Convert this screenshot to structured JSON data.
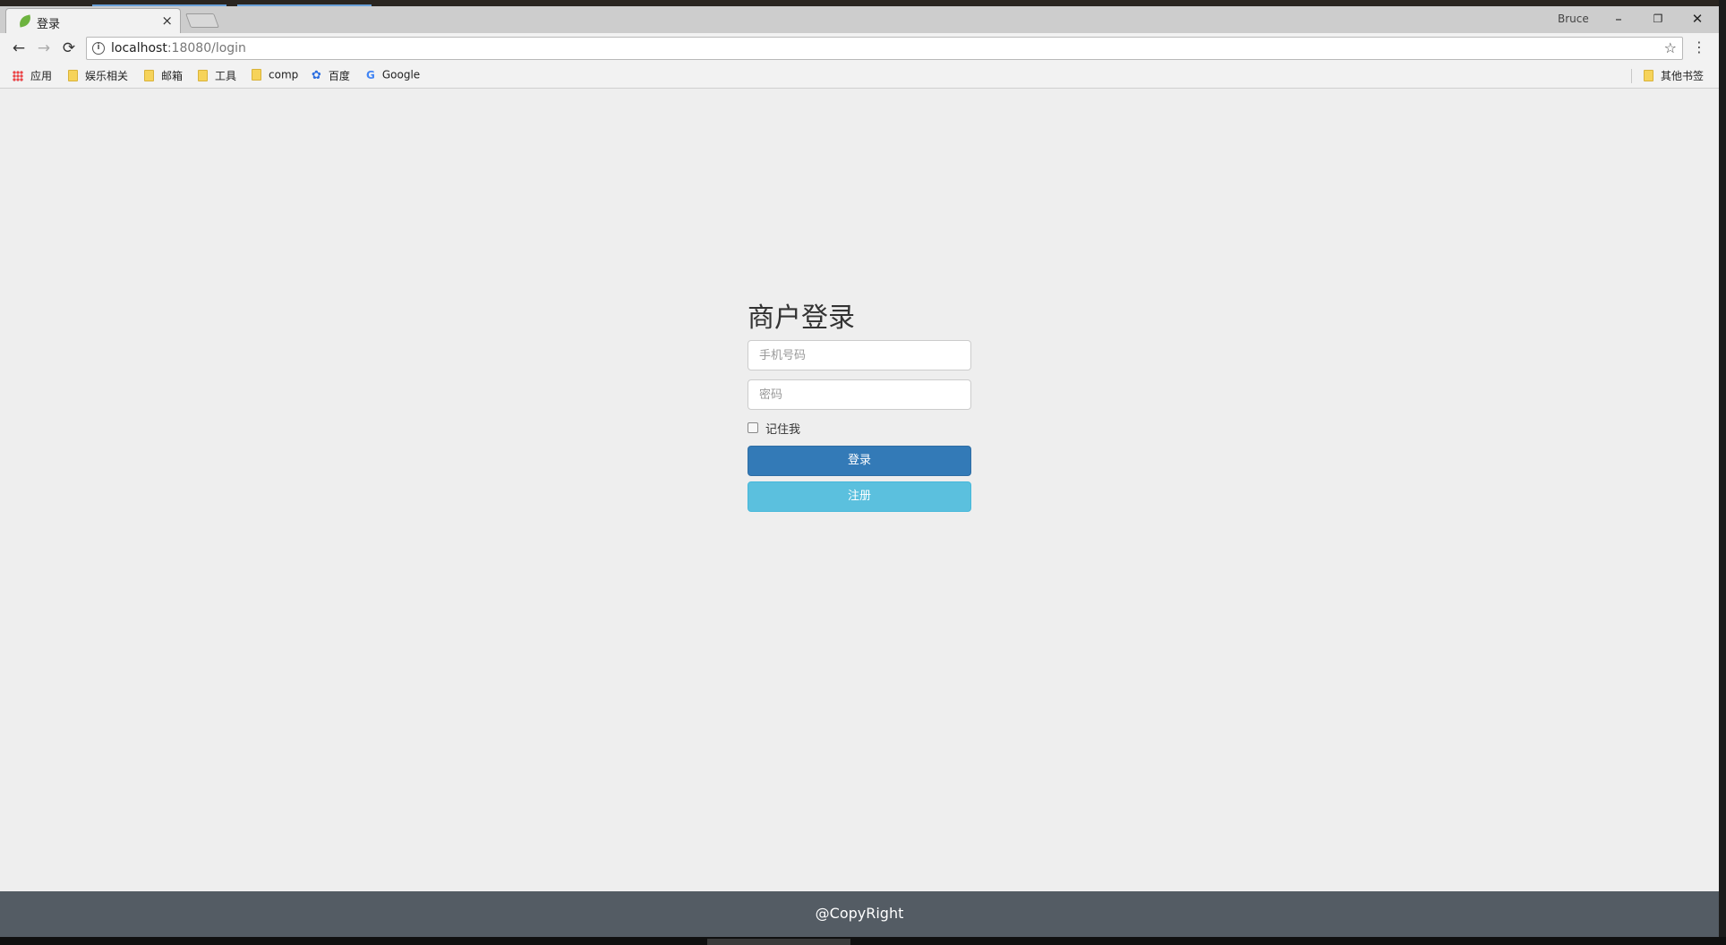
{
  "browser": {
    "tab": {
      "title": "登录",
      "close_glyph": "×"
    },
    "profile": "Bruce",
    "window_buttons": {
      "minimize": "–",
      "restore": "❐",
      "close": "✕"
    },
    "nav": {
      "back": "←",
      "forward": "→",
      "reload": "⟳"
    },
    "address": {
      "host": "localhost",
      "rest": ":18080/login"
    },
    "star_glyph": "☆",
    "menu_glyph": "⋮",
    "bookmarks": [
      {
        "label": "应用",
        "icon": "apps-icon"
      },
      {
        "label": "娱乐相关",
        "icon": "folder-icon"
      },
      {
        "label": "邮箱",
        "icon": "folder-icon"
      },
      {
        "label": "工具",
        "icon": "folder-icon"
      },
      {
        "label": "comp",
        "icon": "folder-icon"
      },
      {
        "label": "百度",
        "icon": "baidu-icon"
      },
      {
        "label": "Google",
        "icon": "google-icon"
      }
    ],
    "other_bookmarks": "其他书签"
  },
  "login": {
    "title": "商户登录",
    "phone_placeholder": "手机号码",
    "password_placeholder": "密码",
    "remember_label": "记住我",
    "login_button": "登录",
    "register_button": "注册"
  },
  "footer": {
    "copyright": "@CopyRight"
  },
  "colors": {
    "primary": "#337ab7",
    "info": "#5bc0de",
    "footer_bg": "#545c64",
    "page_bg": "#eeeeee"
  }
}
